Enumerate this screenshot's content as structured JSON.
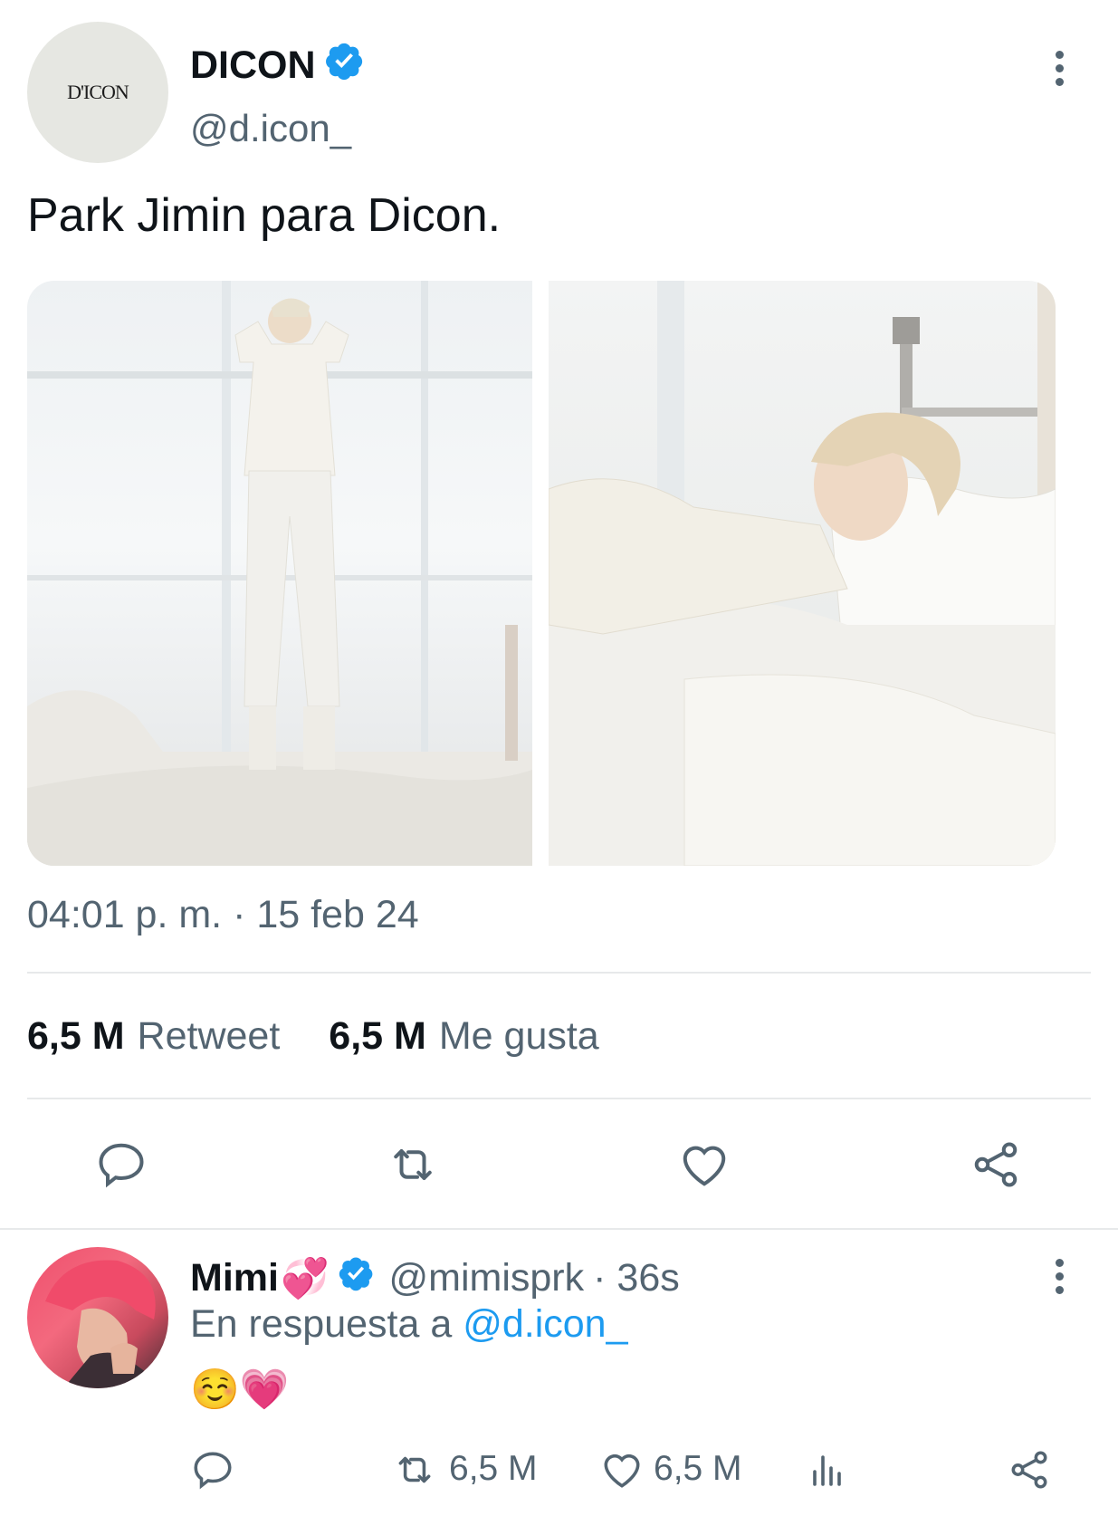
{
  "main_tweet": {
    "avatar_text": "D'ICON",
    "display_name": "DICON",
    "handle": "@d.icon_",
    "text": "Park Jimin para Dicon.",
    "timestamp": "04:01 p. m. · 15 feb 24",
    "stats": {
      "retweets_count": "6,5 M",
      "retweets_label": "Retweet",
      "likes_count": "6,5 M",
      "likes_label": "Me gusta"
    }
  },
  "reply": {
    "display_name": "Mimi",
    "name_emoji": "💞",
    "handle": "@mimisprk",
    "time": "· 36s",
    "replying_prefix": "En respuesta a",
    "replying_to": "@d.icon_",
    "text": "☺️💗",
    "retweets_count": "6,5 M",
    "likes_count": "6,5 M"
  },
  "colors": {
    "verified": "#1d9bf0",
    "secondary_text": "#536471",
    "link": "#1d9bf0"
  },
  "icons": [
    "verified-badge-icon",
    "more-options-icon",
    "reply-icon",
    "retweet-icon",
    "like-icon",
    "share-icon",
    "analytics-icon"
  ]
}
